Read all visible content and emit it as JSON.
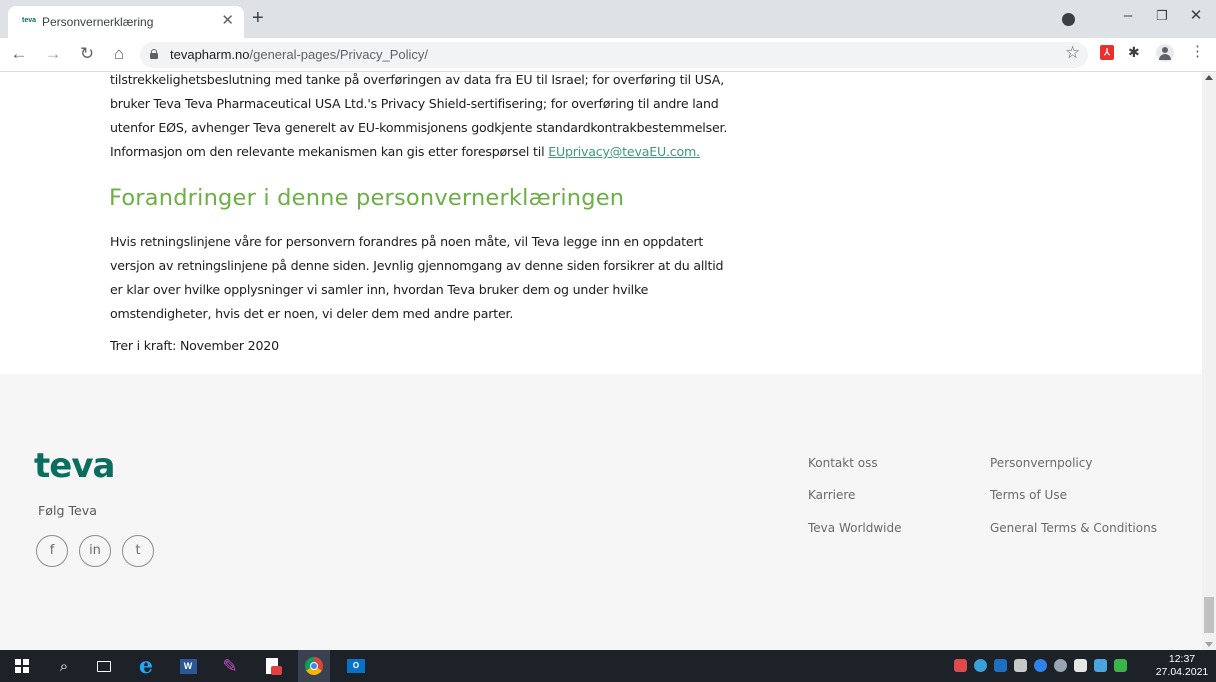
{
  "browser": {
    "tab_title": "Personvernerklæring",
    "tab_favicon_text": "teva",
    "url_domain": "tevapharm.no",
    "url_path": "/general-pages/Privacy_Policy/"
  },
  "content": {
    "intro_lines": [
      "tilstrekkelighetsbeslutning med tanke på overføringen av data fra EU til Israel; for overføring til USA,",
      "bruker Teva Teva Pharmaceutical USA Ltd.'s Privacy Shield-sertifisering; for overføring til andre land",
      "utenfor EØS, avhenger Teva generelt av EU-kommisjonens godkjente standardkontrakbestemmelser.",
      "Informasjon om den relevante mekanismen kan gis etter forespørsel til "
    ],
    "contact_email": "EUprivacy@tevaEU.com.",
    "heading": "Forandringer i denne personvernerklæringen",
    "changes_lines": [
      "Hvis retningslinjene våre for personvern forandres på noen måte, vil Teva legge inn en oppdatert",
      "versjon av retningslinjene på denne siden. Jevnlig gjennomgang av denne siden forsikrer at du alltid",
      "er klar over hvilke opplysninger vi samler inn, hvordan Teva bruker dem og under hvilke",
      "omstendigheter, hvis det er noen, vi deler dem med andre parter."
    ],
    "effective_date": "Trer i kraft: November 2020"
  },
  "footer": {
    "logo": "teva",
    "follow_label": "Følg Teva",
    "social": {
      "facebook": "f",
      "linkedin": "in",
      "twitter": "t"
    },
    "links_col1": [
      "Kontakt oss",
      "Karriere",
      "Teva Worldwide"
    ],
    "links_col2": [
      "Personvernpolicy",
      "Terms of Use",
      "General Terms & Conditions"
    ]
  },
  "taskbar": {
    "time": "12:37",
    "date": "27.04.2021"
  },
  "colors": {
    "heading_green": "#6cb043",
    "logo_teal": "#0a6e5f",
    "link_green": "#3c9b7a",
    "taskbar_bg": "#1d2229"
  }
}
